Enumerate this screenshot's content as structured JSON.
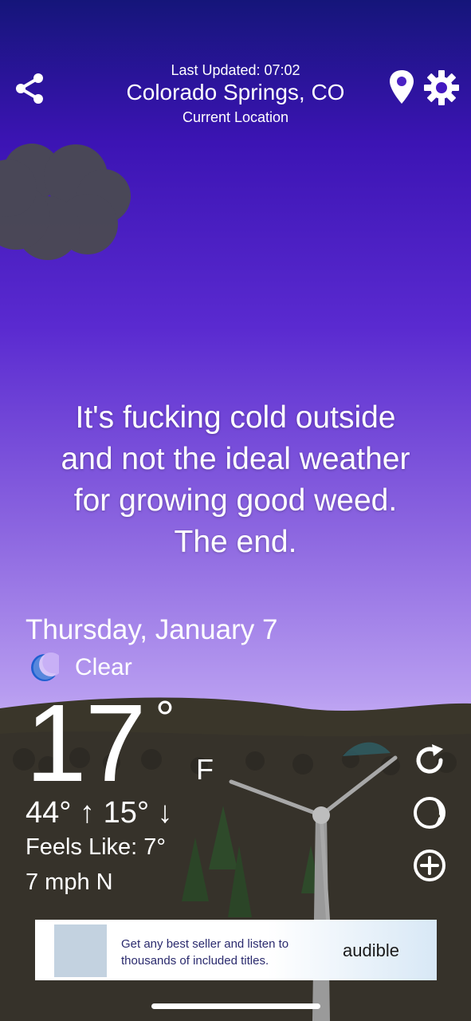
{
  "header": {
    "last_updated": "Last Updated: 07:02",
    "city": "Colorado Springs, CO",
    "location_label": "Current Location"
  },
  "message": {
    "line1": "It's fucking cold outside",
    "line2": "and not the ideal weather",
    "line3": "for growing good weed.",
    "line4": "The end."
  },
  "weather": {
    "date": "Thursday, January 7",
    "condition": "Clear",
    "temperature": "17",
    "degree_symbol": "°",
    "unit": "F",
    "hi_lo": "44° ↑  15° ↓",
    "feels_like": "Feels Like: 7°",
    "wind": "7 mph N"
  },
  "ad": {
    "text": "Get any best seller and listen to thousands of included titles.",
    "brand": "audible"
  },
  "colors": {
    "sky_top": "#15157a",
    "sky_bottom": "#c9b1f6",
    "ground": "#3a362a",
    "moon_icon": "#1f5fd0"
  },
  "icons": [
    "share-icon",
    "location-pin-icon",
    "settings-gear-icon",
    "moon-icon",
    "refresh-icon",
    "moon-phase-icon",
    "add-icon"
  ]
}
